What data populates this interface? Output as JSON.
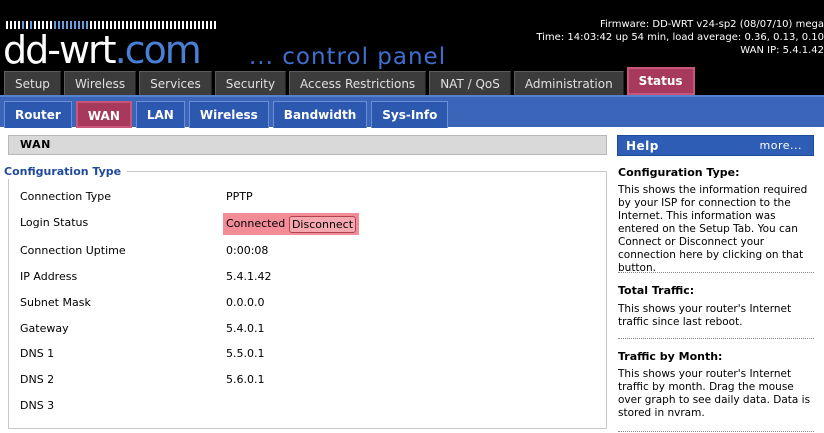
{
  "header": {
    "logo_main": "dd-wrt",
    "logo_suffix": ".com",
    "logo_tagline": "... control panel",
    "firmware": "Firmware: DD-WRT v24-sp2 (08/07/10) mega",
    "time": "Time: 14:03:42 up 54 min, load average: 0.36, 0.13, 0.10",
    "wan_ip": "WAN IP: 5.4.1.42"
  },
  "main_tabs": [
    {
      "label": "Setup"
    },
    {
      "label": "Wireless"
    },
    {
      "label": "Services"
    },
    {
      "label": "Security"
    },
    {
      "label": "Access Restrictions"
    },
    {
      "label": "NAT / QoS"
    },
    {
      "label": "Administration"
    },
    {
      "label": "Status"
    }
  ],
  "sub_tabs": [
    {
      "label": "Router"
    },
    {
      "label": "WAN"
    },
    {
      "label": "LAN"
    },
    {
      "label": "Wireless"
    },
    {
      "label": "Bandwidth"
    },
    {
      "label": "Sys-Info"
    }
  ],
  "content": {
    "section_title": "WAN",
    "legend": "Configuration Type",
    "rows": [
      {
        "label": "Connection Type",
        "value": "PPTP"
      },
      {
        "label": "Login Status",
        "value": "Connected"
      },
      {
        "label": "Connection Uptime",
        "value": "0:00:08"
      },
      {
        "label": "IP Address",
        "value": "5.4.1.42"
      },
      {
        "label": "Subnet Mask",
        "value": "0.0.0.0"
      },
      {
        "label": "Gateway",
        "value": "5.4.0.1"
      },
      {
        "label": "DNS 1",
        "value": "5.5.0.1"
      },
      {
        "label": "DNS 2",
        "value": "5.6.0.1"
      },
      {
        "label": "DNS 3",
        "value": ""
      }
    ],
    "disconnect_label": "Disconnect"
  },
  "help": {
    "title": "Help",
    "more": "more...",
    "sections": [
      {
        "heading": "Configuration Type:",
        "text": "This shows the information required by your ISP for connection to the Internet. This information was entered on the Setup Tab. You can Connect or Disconnect your connection here by clicking on that button."
      },
      {
        "heading": "Total Traffic:",
        "text": "This shows your router's Internet traffic since last reboot."
      },
      {
        "heading": "Traffic by Month:",
        "text": "This shows your router's Internet traffic by month. Drag the mouse over graph to see daily data. Data is stored in nvram."
      }
    ]
  },
  "colors": {
    "active_tab": "#a73a5c",
    "subnav_blue": "#3a65b8",
    "status_connected": "#f28c96"
  }
}
